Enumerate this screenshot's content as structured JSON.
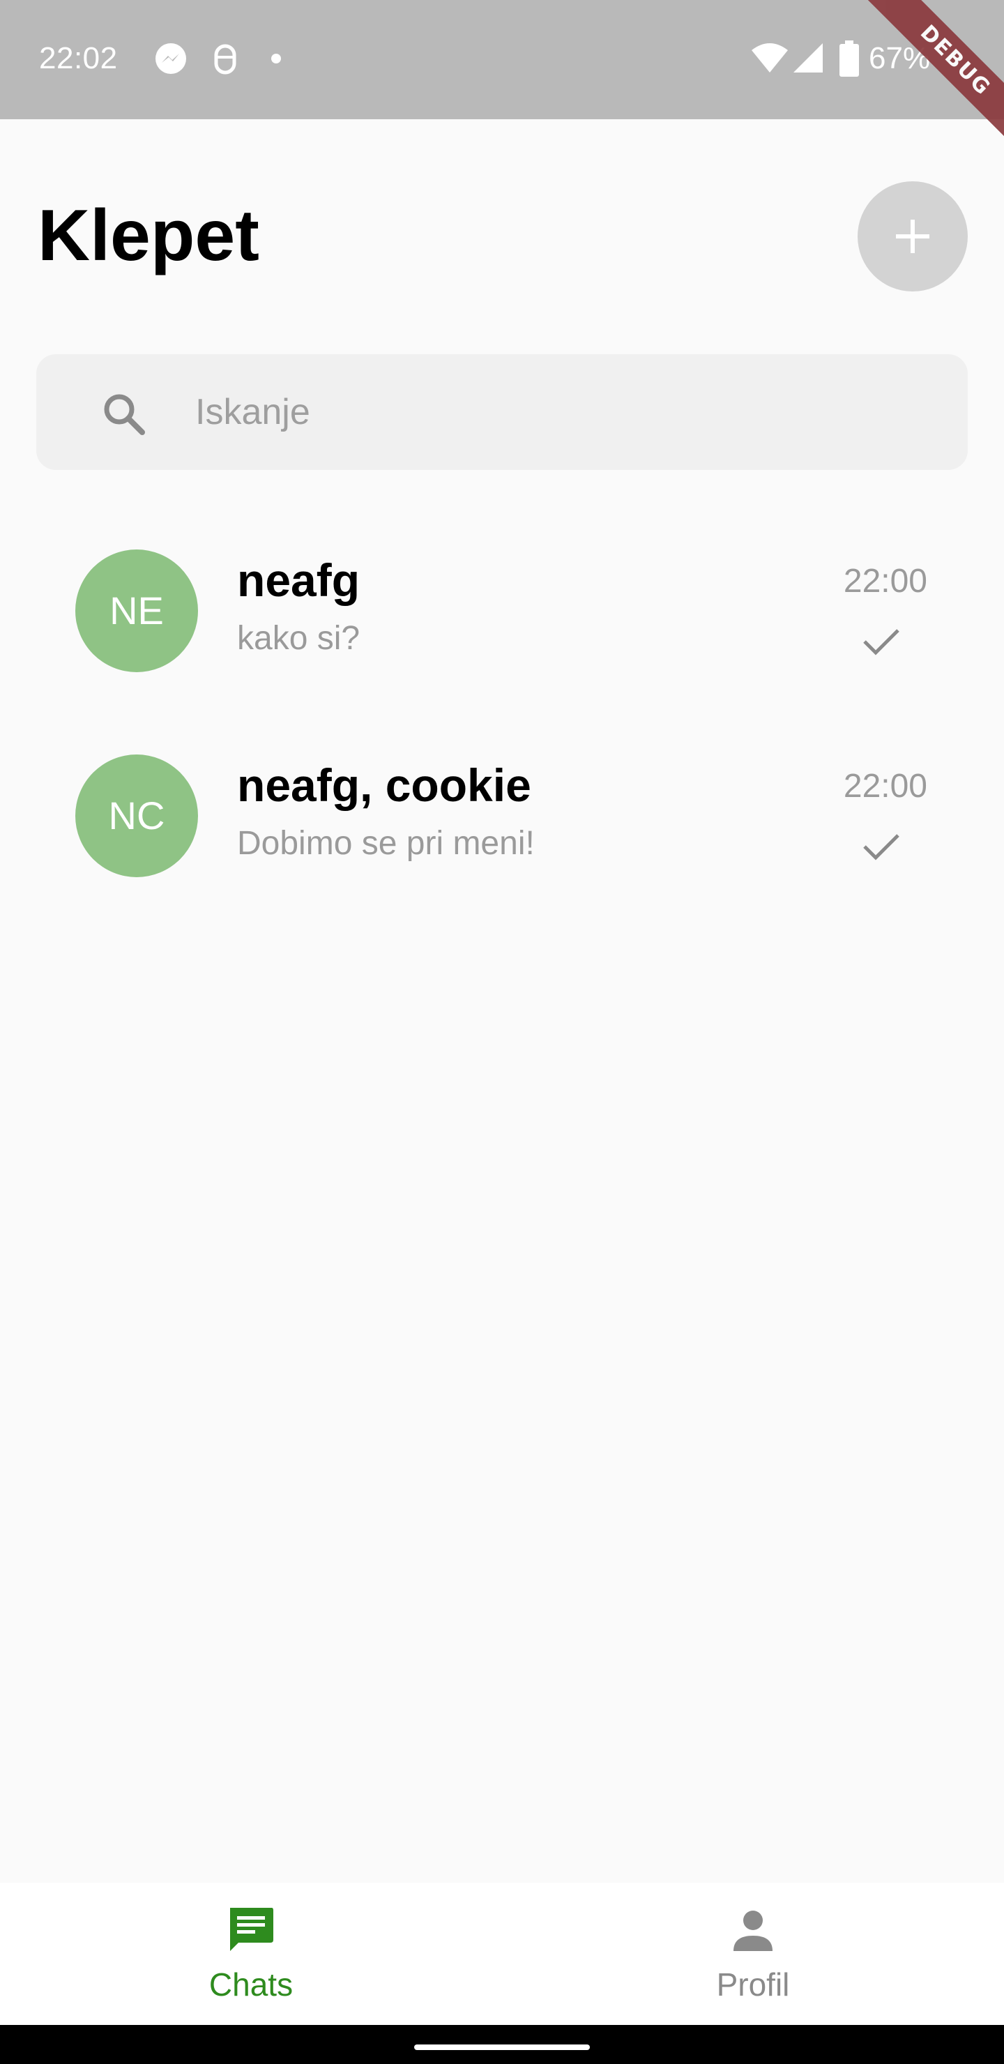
{
  "status_bar": {
    "time": "22:02",
    "battery_percent": "67%",
    "icons": [
      "messenger-icon",
      "bug-icon",
      "dot-icon",
      "wifi-icon",
      "signal-icon",
      "battery-icon"
    ],
    "debug_banner": "DEBUG"
  },
  "header": {
    "title": "Klepet",
    "add_button_icon": "plus-icon"
  },
  "search": {
    "placeholder": "Iskanje",
    "value": "",
    "icon": "search-icon"
  },
  "chats": [
    {
      "initials": "NE",
      "name": "neafg",
      "preview": "kako si?",
      "time": "22:00",
      "status_icon": "check-icon"
    },
    {
      "initials": "NC",
      "name": "neafg, cookie",
      "preview": "Dobimo se pri meni!",
      "time": "22:00",
      "status_icon": "check-icon"
    }
  ],
  "bottom_nav": {
    "items": [
      {
        "label": "Chats",
        "icon": "chat-icon",
        "active": true
      },
      {
        "label": "Profil",
        "icon": "person-icon",
        "active": false
      }
    ]
  },
  "colors": {
    "accent_green": "#2e8b1e",
    "avatar_green": "#8fc385",
    "status_bar_gray": "#b9b9b9"
  }
}
